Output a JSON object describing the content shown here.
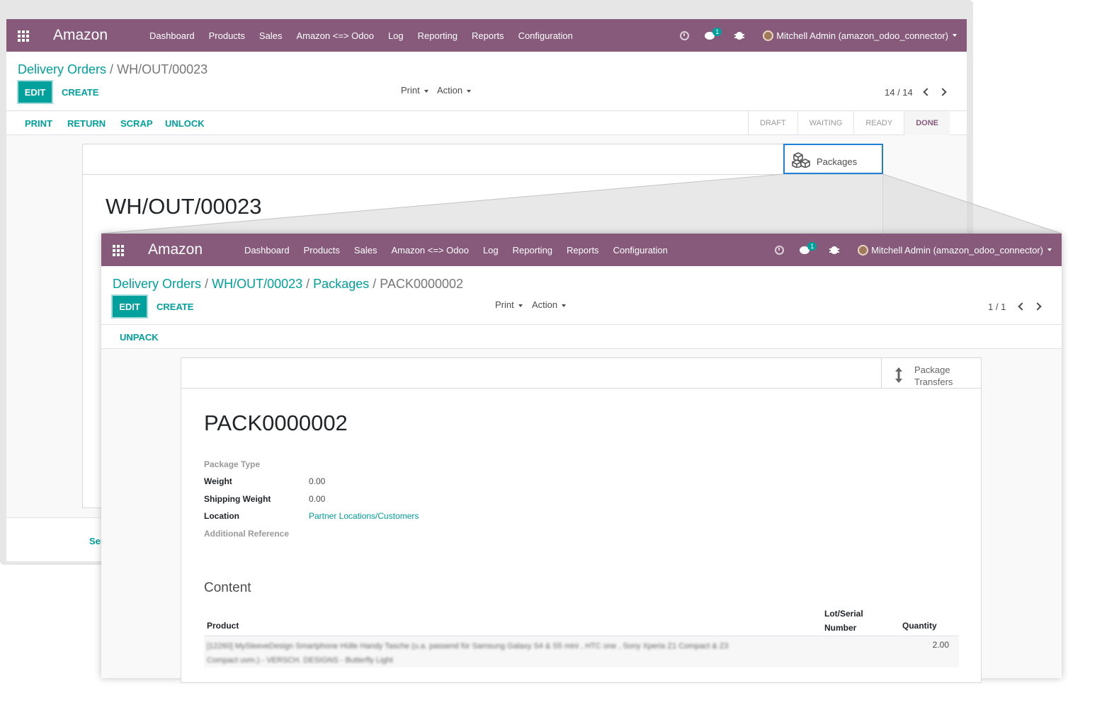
{
  "navbar": {
    "brand": "Amazon",
    "menu": [
      "Dashboard",
      "Products",
      "Sales",
      "Amazon <=> Odoo",
      "Log",
      "Reporting",
      "Reports",
      "Configuration"
    ],
    "chat_count": "1",
    "user": "Mitchell Admin (amazon_odoo_connector)"
  },
  "colors": {
    "navbar": "#875a7b",
    "accent": "#00a09d",
    "highlight_border": "#1e7fd8"
  },
  "back_window": {
    "breadcrumb": {
      "parent": "Delivery Orders",
      "sep": "/",
      "current": "WH/OUT/00023"
    },
    "edit_label": "EDIT",
    "create_label": "CREATE",
    "print_label": "Print",
    "action_label": "Action",
    "pager": "14 / 14",
    "statusbar_buttons": [
      "PRINT",
      "RETURN",
      "SCRAP",
      "UNLOCK"
    ],
    "stages": [
      "DRAFT",
      "WAITING",
      "READY",
      "DONE"
    ],
    "active_stage": "DONE",
    "smart_button": "Packages",
    "record_title": "WH/OUT/00023",
    "footer_partial": "Ser"
  },
  "front_window": {
    "breadcrumb": {
      "level1": "Delivery Orders",
      "level2": "WH/OUT/00023",
      "level3": "Packages",
      "current": "PACK0000002",
      "sep": "/"
    },
    "edit_label": "EDIT",
    "create_label": "CREATE",
    "print_label": "Print",
    "action_label": "Action",
    "pager": "1 / 1",
    "statusbar_buttons": [
      "UNPACK"
    ],
    "smart_button": {
      "line1": "Package",
      "line2": "Transfers"
    },
    "record_title": "PACK0000002",
    "fields": {
      "package_type": {
        "label": "Package Type",
        "value": ""
      },
      "weight": {
        "label": "Weight",
        "value": "0.00"
      },
      "shipping_weight": {
        "label": "Shipping Weight",
        "value": "0.00"
      },
      "location": {
        "label": "Location",
        "value": "Partner Locations/Customers"
      },
      "additional_reference": {
        "label": "Additional Reference",
        "value": ""
      }
    },
    "content": {
      "title": "Content",
      "columns": {
        "product": "Product",
        "lot_line1": "Lot/Serial",
        "lot_line2": "Number",
        "quantity": "Quantity"
      },
      "rows": [
        {
          "product_line1": "[12260] MySleeveDesign Smartphone Hülle Handy Tasche (u.a. passend für Samsung Galaxy S4 & S5 mini , HTC one , Sony Xperia Z1 Compact & Z3",
          "product_line2": "Compact uvm.) - VERSCH. DESIGNS - Butterfly Light",
          "lot": "",
          "quantity": "2.00"
        }
      ]
    }
  }
}
